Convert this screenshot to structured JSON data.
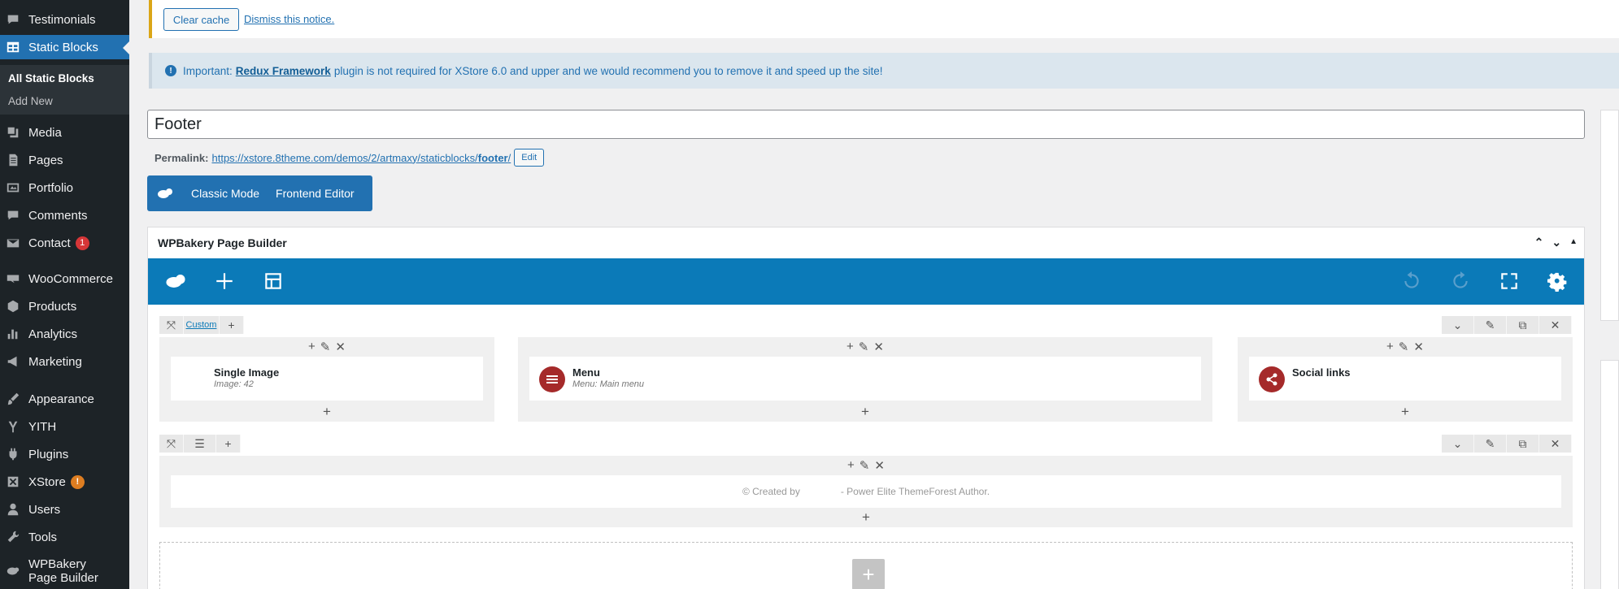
{
  "sidebar": {
    "items": [
      {
        "label": "Testimonials",
        "icon": "comment-icon",
        "active": false
      },
      {
        "label": "Static Blocks",
        "icon": "table-icon",
        "active": true
      },
      {
        "label": "Media",
        "icon": "media-icon"
      },
      {
        "label": "Pages",
        "icon": "pages-icon"
      },
      {
        "label": "Portfolio",
        "icon": "portfolio-icon"
      },
      {
        "label": "Comments",
        "icon": "comments-icon"
      },
      {
        "label": "Contact",
        "icon": "mail-icon",
        "badge": "1"
      },
      {
        "label": "WooCommerce",
        "icon": "woocommerce-icon"
      },
      {
        "label": "Products",
        "icon": "products-icon"
      },
      {
        "label": "Analytics",
        "icon": "analytics-icon"
      },
      {
        "label": "Marketing",
        "icon": "megaphone-icon"
      },
      {
        "label": "Appearance",
        "icon": "brush-icon"
      },
      {
        "label": "YITH",
        "icon": "yith-icon"
      },
      {
        "label": "Plugins",
        "icon": "plugin-icon"
      },
      {
        "label": "XStore",
        "icon": "xstore-icon",
        "badge": "!"
      },
      {
        "label": "Users",
        "icon": "users-icon"
      },
      {
        "label": "Tools",
        "icon": "wrench-icon"
      },
      {
        "label": "WPBakery Page Builder",
        "icon": "wpbakery-icon"
      }
    ],
    "submenu": {
      "all": "All Static Blocks",
      "add": "Add New"
    }
  },
  "notices": {
    "clear_cache": "Clear cache",
    "dismiss": "Dismiss this notice.",
    "redux_prefix": "Important:",
    "redux_link": "Redux Framework",
    "redux_text": "plugin is not required for XStore 6.0 and upper and we would recommend you to remove it and speed up the site!"
  },
  "post": {
    "title": "Footer",
    "permalink_label": "Permalink:",
    "permalink_url": "https://xstore.8theme.com/demos/2/artmaxy/staticblocks/",
    "permalink_slug": "footer",
    "permalink_end": "/",
    "edit_label": "Edit"
  },
  "modes": {
    "classic": "Classic Mode",
    "frontend": "Frontend Editor"
  },
  "builder": {
    "title": "WPBakery Page Builder",
    "row1_custom": "Custom",
    "elements": [
      {
        "title": "Single Image",
        "sub": "Image: 42"
      },
      {
        "title": "Menu",
        "sub": "Menu: Main menu"
      },
      {
        "title": "Social links",
        "sub": ""
      }
    ],
    "footer_text_a": "© Created by",
    "footer_text_b": "- Power Elite ThemeForest Author."
  },
  "colors": {
    "accent": "#2271b1",
    "builder_bar": "#0b7ab8",
    "element_icon": "#a52a2a"
  }
}
